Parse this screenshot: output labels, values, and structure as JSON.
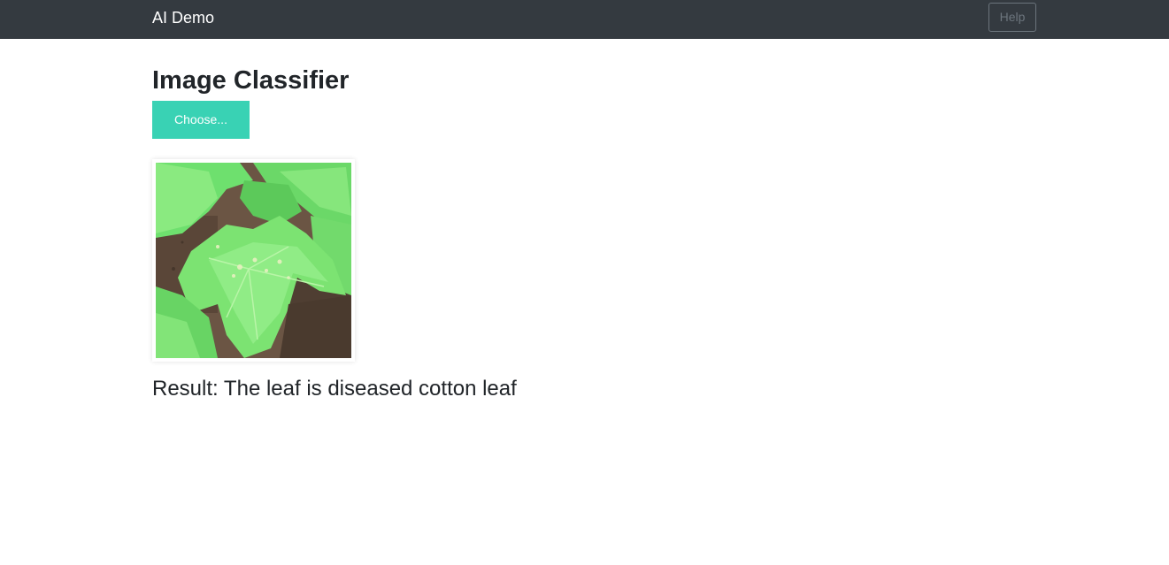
{
  "navbar": {
    "brand": "AI Demo",
    "help_label": "Help"
  },
  "main": {
    "title": "Image Classifier",
    "choose_label": "Choose...",
    "preview_icon": "leaf-image",
    "result_text": "Result: The leaf is diseased cotton leaf"
  },
  "colors": {
    "navbar_bg": "#343a40",
    "accent": "#39d2b4",
    "text": "#212529"
  }
}
